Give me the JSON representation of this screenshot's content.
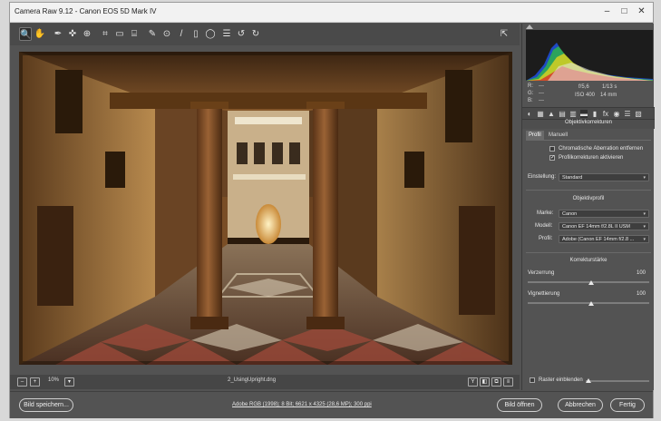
{
  "window": {
    "title": "Camera Raw 9.12 - Canon EOS 5D Mark IV",
    "controls": {
      "minimize": "–",
      "maximize": "□",
      "close": "✕"
    }
  },
  "toolbar": {
    "tools": [
      {
        "name": "zoom-icon",
        "glyph": "🔍"
      },
      {
        "name": "hand-icon",
        "glyph": "✋"
      },
      {
        "name": "white-balance-icon",
        "glyph": "✒"
      },
      {
        "name": "color-sampler-icon",
        "glyph": "✜"
      },
      {
        "name": "targeted-adjust-icon",
        "glyph": "⊕"
      },
      {
        "name": "crop-icon",
        "glyph": "⌗"
      },
      {
        "name": "straighten-icon",
        "glyph": "▭"
      },
      {
        "name": "transform-icon",
        "glyph": "⌸"
      },
      {
        "name": "spot-removal-icon",
        "glyph": "✎"
      },
      {
        "name": "red-eye-icon",
        "glyph": "⊙"
      },
      {
        "name": "adjustment-brush-icon",
        "glyph": "/"
      },
      {
        "name": "graduated-filter-icon",
        "glyph": "▯"
      },
      {
        "name": "radial-filter-icon",
        "glyph": "◯"
      },
      {
        "name": "preferences-icon",
        "glyph": "☰"
      },
      {
        "name": "rotate-left-icon",
        "glyph": "↺"
      },
      {
        "name": "rotate-right-icon",
        "glyph": "↻"
      }
    ],
    "export_icon": "⇱"
  },
  "status": {
    "zoom_minus": "–",
    "zoom_value": "10%",
    "zoom_plus": "+",
    "filename": "2_UsingUpright.dng",
    "view_buttons": [
      "Y",
      "◧",
      "⧉",
      "≡"
    ]
  },
  "bottom": {
    "save_label": "Bild speichern...",
    "workflow_info": "Adobe RGB (1998); 8 Bit; 6621 x 4325 (28,6 MP); 300 ppi",
    "open_label": "Bild öffnen",
    "cancel_label": "Abbrechen",
    "done_label": "Fertig"
  },
  "readout": {
    "r_label": "R:",
    "r_value": "---",
    "g_label": "G:",
    "g_value": "---",
    "b_label": "B:",
    "b_value": "---",
    "aperture": "f/5,6",
    "shutter": "1/13 s",
    "iso": "ISO 400",
    "focal": "14 mm"
  },
  "panel": {
    "tab_icons": [
      "◐",
      "▦",
      "▲",
      "▤",
      "▥",
      "▬",
      "▮",
      "fx",
      "◉",
      "☰",
      "▧"
    ],
    "title": "Objektivkorrekturen",
    "subtabs": [
      "Profil",
      "Manuell"
    ],
    "chromatic_label": "Chromatische Aberration entfernen",
    "chromatic_checked": "",
    "profile_label": "Profilkorrekturen aktivieren",
    "profile_checked": "✓",
    "setup_label": "Einstellung:",
    "setup_value": "Standard",
    "lens_section": "Objektivprofil",
    "make_label": "Marke:",
    "make_value": "Canon",
    "model_label": "Modell:",
    "model_value": "Canon EF 14mm f/2.8L II USM",
    "profile_sel_label": "Profil:",
    "profile_value": "Adobe (Canon EF 14mm f/2.8 ...",
    "correction_section": "Korrekturstärke",
    "distortion_label": "Verzerrung",
    "distortion_value": "100",
    "vignetting_label": "Vignettierung",
    "vignetting_value": "100",
    "raster_label": "Raster einblenden"
  },
  "colors": {
    "panel_bg": "#535353",
    "title_bg": "#f2f2f2",
    "histogram_bg": "#1c1c1c"
  }
}
